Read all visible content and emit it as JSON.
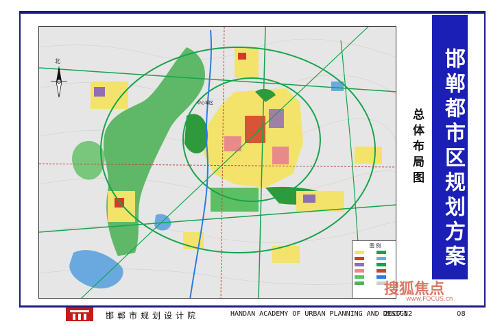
{
  "title": {
    "main": "邯郸都市区规划方案",
    "sub": "总体布局图"
  },
  "footer": {
    "org_cn": "邯郸市规划设计院",
    "org_en": "HANDAN ACADEMY OF URBAN PLANNING AND DESIGN",
    "date": "2007.12",
    "page": "08"
  },
  "map": {
    "north_label": "北",
    "legend_title": "图 例",
    "landmark_label": "中心城区"
  },
  "watermark": {
    "brand": "搜狐焦点",
    "url": "www.FOCUS.cn"
  },
  "colors": {
    "frame_blue": "#1a1a8c",
    "panel_blue": "#1b1fb5",
    "forest_green": "#4fb35a",
    "residential_yellow": "#f3e36b",
    "industrial_purple": "#8f6fb0",
    "commercial_red": "#d33a2c",
    "water_blue": "#6aa9e0",
    "logo_red": "#c81818"
  }
}
